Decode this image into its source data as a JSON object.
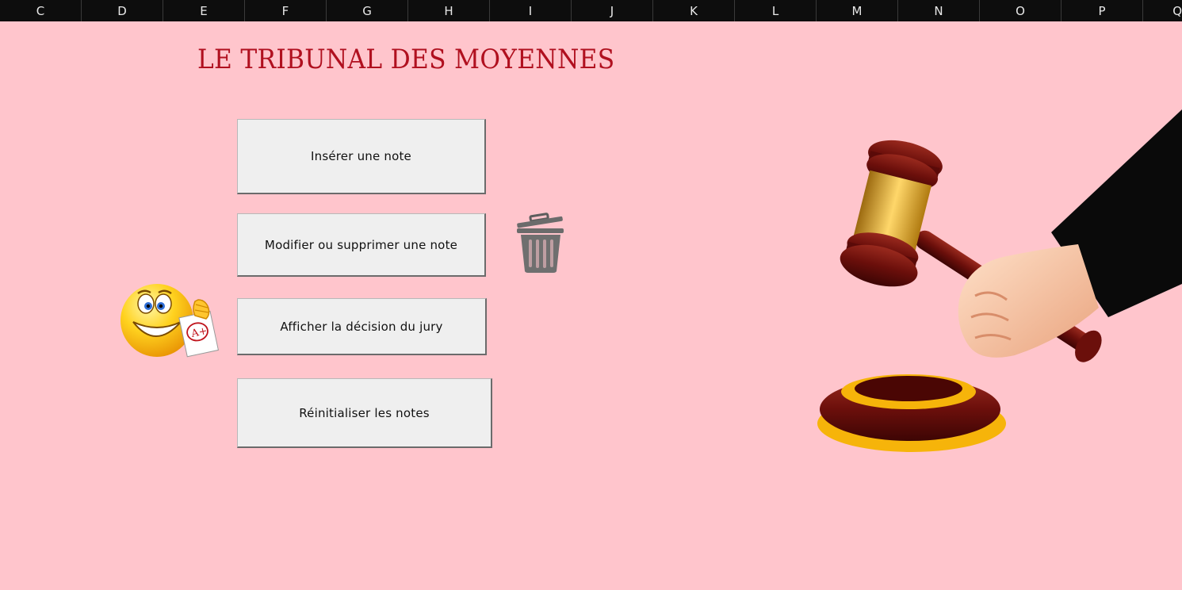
{
  "column_headers": [
    "C",
    "D",
    "E",
    "F",
    "G",
    "H",
    "I",
    "J",
    "K",
    "L",
    "M",
    "N",
    "O",
    "P",
    "Q"
  ],
  "title": "LE TRIBUNAL DES MOYENNES",
  "buttons": {
    "insert": "Insérer une note",
    "modify": "Modifier ou supprimer une note",
    "show": "Afficher la décision du jury",
    "reset": "Réinitialiser les notes"
  },
  "icons": {
    "trash": "trash-bin-icon",
    "smiley": "smiley-with-a-plus-paper-icon",
    "gavel": "gavel-with-hand-icon"
  },
  "smiley_paper_text": "A+",
  "colors": {
    "background": "#ffc5cc",
    "title": "#b0101f",
    "button_face": "#efefef"
  }
}
